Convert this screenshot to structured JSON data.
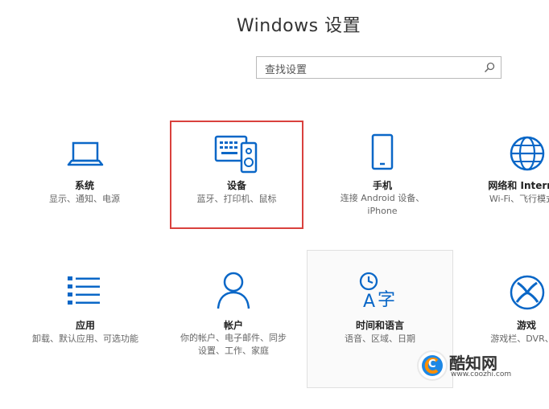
{
  "window": {
    "title": "Windows 设置"
  },
  "search": {
    "placeholder": "查找设置",
    "icon": "search-icon"
  },
  "tiles": [
    {
      "name": "系统",
      "desc": "显示、通知、电源",
      "icon": "laptop-icon"
    },
    {
      "name": "设备",
      "desc": "蓝牙、打印机、鼠标",
      "icon": "devices-icon"
    },
    {
      "name": "手机",
      "desc1": "连接 Android 设备、",
      "desc2": "iPhone",
      "icon": "phone-icon"
    },
    {
      "name": "网络和 Internet",
      "desc": "Wi-Fi、飞行模式、",
      "icon": "globe-icon"
    },
    {
      "name": "应用",
      "desc": "卸载、默认应用、可选功能",
      "icon": "apps-list-icon"
    },
    {
      "name": "帐户",
      "desc1": "你的帐户、电子邮件、同步",
      "desc2": "设置、工作、家庭",
      "icon": "person-icon"
    },
    {
      "name": "时间和语言",
      "desc": "语音、区域、日期",
      "icon": "time-language-icon"
    },
    {
      "name": "游戏",
      "desc": "游戏栏、DVR、广",
      "icon": "xbox-icon"
    }
  ],
  "watermark": {
    "brand": "酷知网",
    "url": "www.coozhi.com",
    "logo_letter": "C"
  },
  "colors": {
    "accent": "#0a67c7",
    "highlight": "#d9413d"
  }
}
